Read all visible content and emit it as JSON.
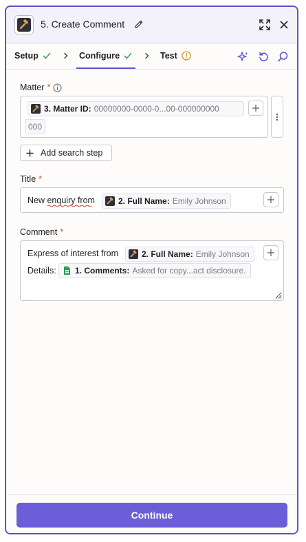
{
  "header": {
    "title": "5. Create Comment",
    "app_icon": "gavel-app-icon",
    "edit_icon": "pencil-icon",
    "expand_icon": "expand-icon",
    "close_icon": "close-icon"
  },
  "tabs": [
    {
      "label": "Setup",
      "status": "complete"
    },
    {
      "label": "Configure",
      "status": "complete",
      "active": true
    },
    {
      "label": "Test",
      "status": "warning"
    }
  ],
  "toolbar_icons": [
    "sparkle-icon",
    "undo-icon",
    "search-icon"
  ],
  "fields": {
    "matter": {
      "label": "Matter",
      "required_mark": "*",
      "pill": {
        "label": "3. Matter ID:",
        "value": "00000000-0000-0...00-000000000"
      },
      "value_overflow": "000"
    },
    "add_search_step": "Add search step",
    "title": {
      "label": "Title",
      "required_mark": "*",
      "prefix": "New enquiry from",
      "pill": {
        "label": "2. Full Name:",
        "value": "Emily Johnson"
      }
    },
    "comment": {
      "label": "Comment",
      "required_mark": "*",
      "line1_prefix": "Express of interest from",
      "line1_pill": {
        "label": "2. Full Name:",
        "value": "Emily Johnson"
      },
      "line2_prefix": "Details:",
      "line2_pill": {
        "label": "1. Comments:",
        "value": "Asked for copy...act disclosure."
      }
    }
  },
  "footer": {
    "continue_label": "Continue"
  },
  "colors": {
    "accent": "#5b51cf",
    "button": "#6b5ed8",
    "success": "#3aa56b",
    "warning": "#c99a1c",
    "required": "#d2562d"
  }
}
